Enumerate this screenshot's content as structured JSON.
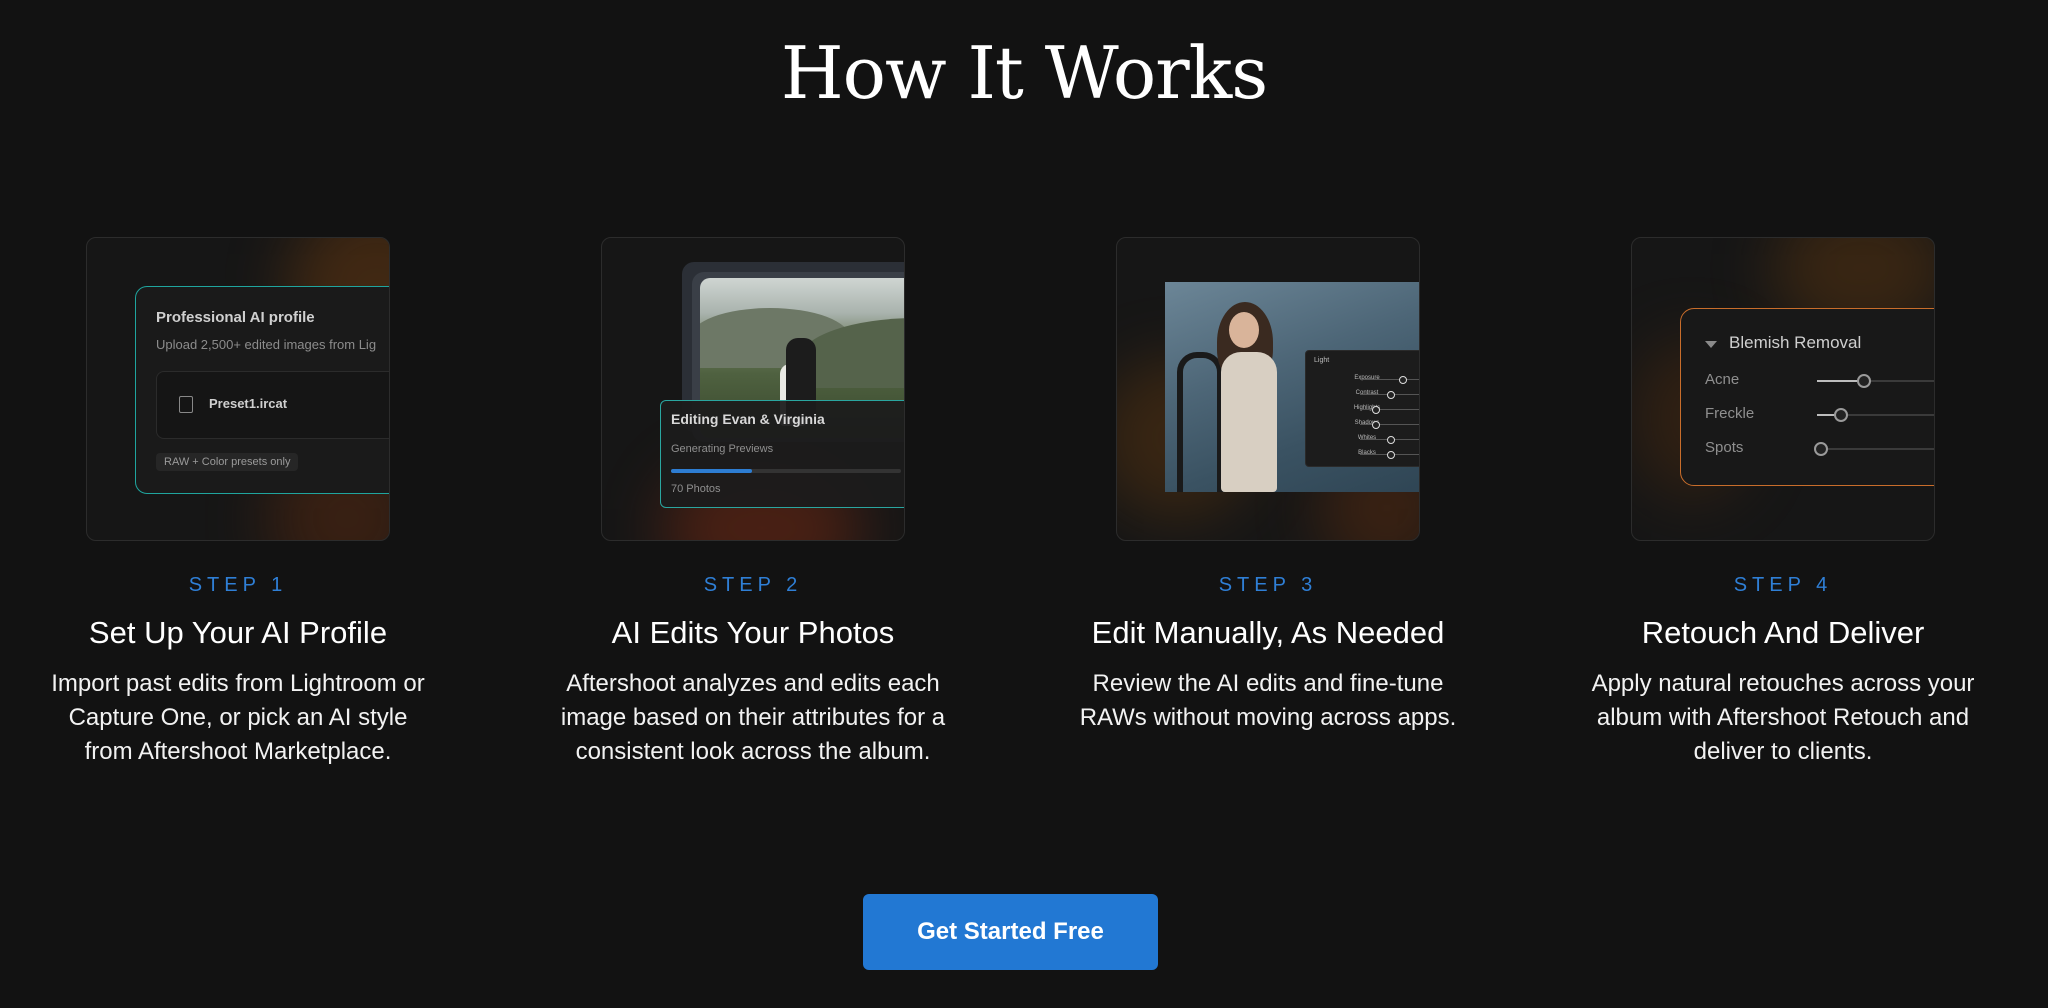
{
  "page": {
    "title": "How It Works"
  },
  "steps": [
    {
      "label": "STEP 1",
      "heading": "Set Up Your AI Profile",
      "description": "Import past edits from Lightroom or Capture One, or pick an AI style from Aftershoot Marketplace.",
      "card": {
        "panel_title": "Professional AI profile",
        "panel_subtitle": "Upload 2,500+ edited images from Lig",
        "file_name": "Preset1.ircat",
        "chip": "RAW + Color presets only",
        "accent": "#1fa59e"
      }
    },
    {
      "label": "STEP 2",
      "heading": "AI Edits Your Photos",
      "description": "Aftershoot analyzes and edits each image based on their attributes for a consistent look across the album.",
      "card": {
        "panel_title": "Editing Evan & Virginia",
        "status": "Generating Previews",
        "photo_count": "70 Photos",
        "progress": 0.35,
        "accent": "#2d7dd2"
      }
    },
    {
      "label": "STEP 3",
      "heading": "Edit Manually, As Needed",
      "description": "Review the AI edits and fine-tune RAWs without moving across apps.",
      "card": {
        "panel_heading": "Light",
        "sliders": [
          {
            "name": "Exposure",
            "value": 0.7
          },
          {
            "name": "Contrast",
            "value": 0.5
          },
          {
            "name": "Highlights",
            "value": 0.25
          },
          {
            "name": "Shadows",
            "value": 0.25
          },
          {
            "name": "Whites",
            "value": 0.5
          },
          {
            "name": "Blacks",
            "value": 0.5
          }
        ]
      }
    },
    {
      "label": "STEP 4",
      "heading": "Retouch And Deliver",
      "description": "Apply natural retouches across your album with Aftershoot Retouch and deliver to clients.",
      "card": {
        "panel_title": "Blemish Removal",
        "sliders": [
          {
            "name": "Acne",
            "value": 0.35
          },
          {
            "name": "Freckle",
            "value": 0.18
          },
          {
            "name": "Spots",
            "value": 0.02
          }
        ],
        "accent": "#c86d2b"
      }
    }
  ],
  "cta": {
    "label": "Get Started Free",
    "color": "#2278d3"
  },
  "colors": {
    "background": "#121212",
    "step_label": "#2f7fd6"
  }
}
